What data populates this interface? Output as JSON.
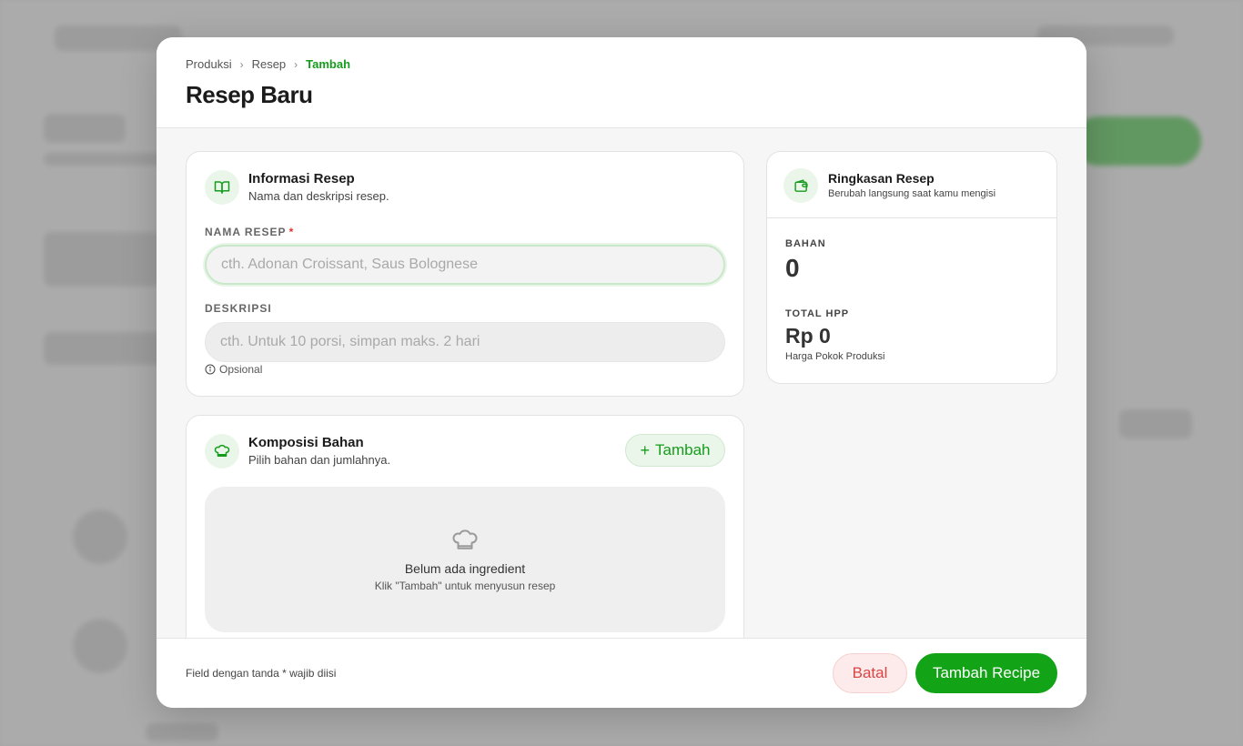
{
  "breadcrumb": {
    "items": [
      "Produksi",
      "Resep",
      "Tambah"
    ]
  },
  "modal": {
    "title": "Resep Baru"
  },
  "info_card": {
    "icon": "open-book-icon",
    "title": "Informasi Resep",
    "subtitle": "Nama dan deskripsi resep.",
    "name_label": "NAMA RESEP",
    "required_mark": "*",
    "name_placeholder": "cth. Adonan Croissant, Saus Bolognese",
    "desc_label": "DESKRIPSI",
    "desc_placeholder": "cth. Untuk 10 porsi, simpan maks. 2 hari",
    "optional_hint": "Opsional"
  },
  "composition_card": {
    "icon": "chef-hat-icon",
    "title": "Komposisi Bahan",
    "subtitle": "Pilih bahan dan jumlahnya.",
    "add_label": "Tambah",
    "empty_title": "Belum ada ingredient",
    "empty_subtitle": "Klik \"Tambah\" untuk menyusun resep"
  },
  "summary_card": {
    "icon": "wallet-icon",
    "title": "Ringkasan Resep",
    "subtitle": "Berubah langsung saat kamu mengisi",
    "bahan_label": "BAHAN",
    "bahan_value": "0",
    "hpp_label": "TOTAL HPP",
    "hpp_value": "Rp 0",
    "hpp_note": "Harga Pokok Produksi"
  },
  "footer": {
    "note": "Field dengan tanda * wajib diisi",
    "cancel_label": "Batal",
    "submit_label": "Tambah Recipe"
  },
  "colors": {
    "accent": "#12a316",
    "danger": "#d94545"
  }
}
